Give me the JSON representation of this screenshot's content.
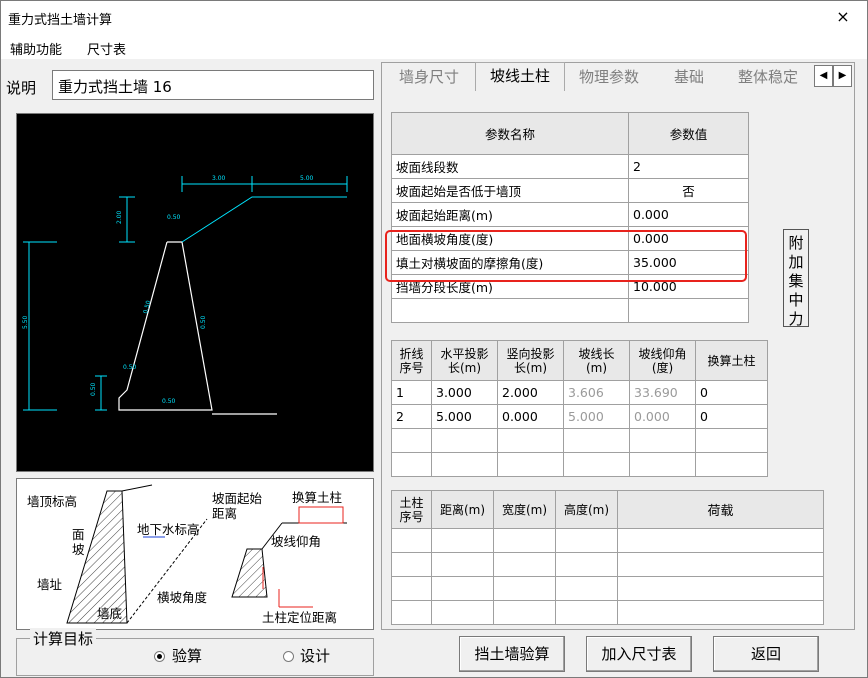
{
  "window": {
    "title": "重力式挡土墙计算",
    "close_glyph": "×"
  },
  "menu": {
    "items": [
      "辅助功能",
      "尺寸表"
    ]
  },
  "desc": {
    "label": "说明",
    "value": "重力式挡土墙 16"
  },
  "tabs": [
    "墙身尺寸",
    "坡线土柱",
    "物理参数",
    "基础",
    "整体稳定"
  ],
  "tabs_active": 1,
  "tab_scroll": {
    "left": "◀",
    "right": "▶"
  },
  "param_table": {
    "headers": [
      "参数名称",
      "参数值"
    ],
    "rows": [
      [
        "坡面线段数",
        "2"
      ],
      [
        "坡面起始是否低于墙顶",
        "否"
      ],
      [
        "坡面起始距离(m)",
        "0.000"
      ],
      [
        "地面横坡角度(度)",
        "0.000"
      ],
      [
        "填土对横坡面的摩擦角(度)",
        "35.000"
      ],
      [
        "挡墙分段长度(m)",
        "10.000"
      ],
      [
        "",
        ""
      ]
    ]
  },
  "side_button": {
    "label": "附加集中力"
  },
  "slope_table": {
    "headers": [
      "折线序号",
      "水平投影长(m)",
      "竖向投影长(m)",
      "坡线长(m)",
      "坡线仰角(度)",
      "换算土柱"
    ],
    "rows": [
      [
        "1",
        "3.000",
        "2.000",
        "3.606",
        "33.690",
        "0"
      ],
      [
        "2",
        "5.000",
        "0.000",
        "5.000",
        "0.000",
        "0"
      ],
      [
        "",
        "",
        "",
        "",
        "",
        ""
      ],
      [
        "",
        "",
        "",
        "",
        "",
        ""
      ]
    ]
  },
  "soil_table": {
    "headers": [
      "土柱序号",
      "距离(m)",
      "宽度(m)",
      "高度(m)",
      "荷载"
    ],
    "rows": [
      [
        "",
        "",
        "",
        "",
        ""
      ],
      [
        "",
        "",
        "",
        "",
        ""
      ],
      [
        "",
        "",
        "",
        "",
        ""
      ],
      [
        "",
        "",
        "",
        "",
        ""
      ]
    ]
  },
  "diagram": {
    "labels": [
      "墙顶标高",
      "坡面起始距离",
      "换算土柱",
      "面坡",
      "地下水标高",
      "坡线仰角",
      "墙址",
      "横坡角度",
      "墙底",
      "土柱定位距离"
    ]
  },
  "cad": {
    "labels": [
      "3.00",
      "5.00",
      "2.00",
      "0.50",
      "5.50",
      "0.50",
      "0.50",
      "0.50",
      "0.50",
      "0.50"
    ]
  },
  "calc_target": {
    "label": "计算目标",
    "options": [
      "验算",
      "设计"
    ],
    "selected": 0
  },
  "buttons": {
    "check": "挡土墙验算",
    "add_size": "加入尺寸表",
    "back": "返回"
  },
  "colors": {
    "highlight": "#e8231d",
    "cad_line": "#00e5ff",
    "cad_bg": "#000000"
  }
}
